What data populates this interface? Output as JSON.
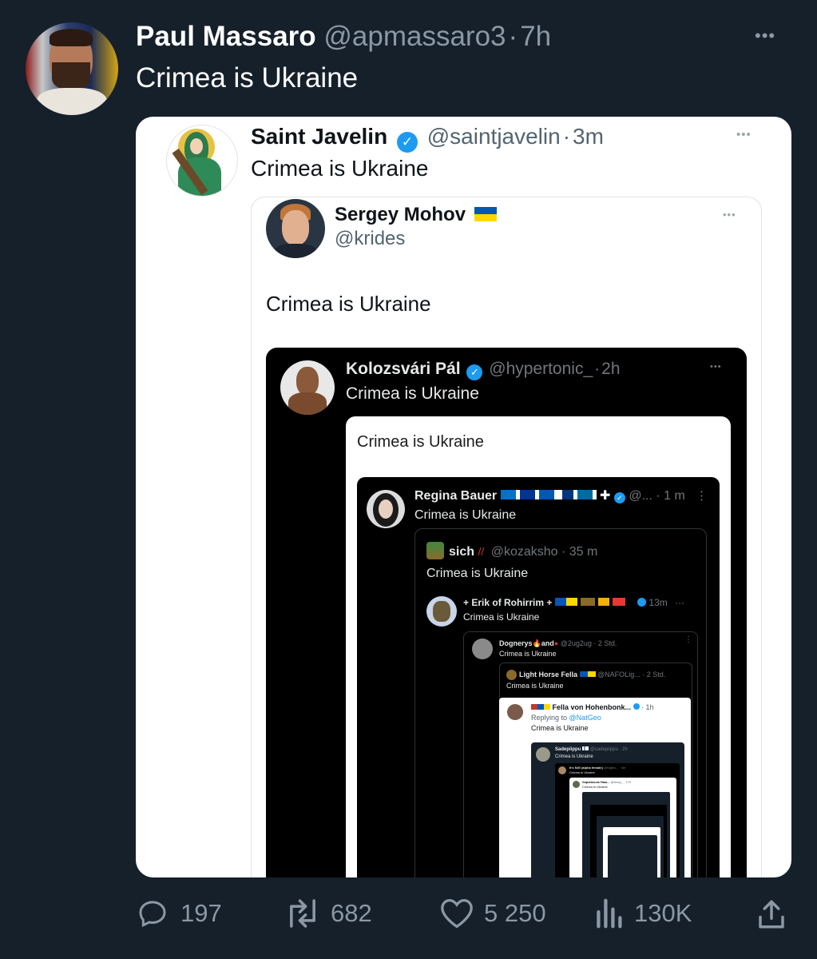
{
  "main": {
    "name": "Paul Massaro",
    "handle": "@apmassaro3",
    "sep": "·",
    "time": "7h",
    "text": "Crimea is Ukraine",
    "more": "•••"
  },
  "q1": {
    "name": "Saint Javelin",
    "handle": "@saintjavelin",
    "sep": "·",
    "time": "3m",
    "text": "Crimea is Ukraine",
    "more": "•••"
  },
  "q2": {
    "name": "Sergey Mohov",
    "flag": "ukraine-flag",
    "handle": "@krides",
    "text": "Crimea is Ukraine",
    "more": "•••"
  },
  "q3": {
    "name": "Kolozsvári Pál",
    "handle": "@hypertonic_",
    "sep": "·",
    "time": "2h",
    "text": "Crimea is Ukraine",
    "more": "•••"
  },
  "q4": {
    "text": "Crimea is Ukraine"
  },
  "q5": {
    "name": "Regina Bauer",
    "handle": "@...",
    "time": "· 1 m",
    "text": "Crimea is Ukraine",
    "more": "⋮"
  },
  "q6": {
    "name": "sich",
    "handle": "@kozaksho",
    "time": "· 35 m",
    "text": "Crimea is Ukraine"
  },
  "q7": {
    "name": "+ Erik of Rohirrim +",
    "time": "13m",
    "text": "Crimea is Ukraine",
    "more": "···"
  },
  "q8": {
    "name": "Dognerys",
    "mid": "and",
    "handle": "@2ug2ug · 2 Std.",
    "text": "Crimea is Ukraine",
    "more": "⋮"
  },
  "q9": {
    "name": "Light Horse Fella",
    "handle": "@NAFOLig... · 2 Std.",
    "text": "Crimea is Ukraine"
  },
  "q10": {
    "name": "Fella von Hohenbonk...",
    "time": "· 1h",
    "reply_prefix": "Replying to",
    "reply_to": "@NatGeo",
    "text": "Crimea is Ukraine"
  },
  "q11": {
    "name": "Sadepiippu",
    "handle": "@sadepiippu · 2h",
    "text": "Crimea is Ukraine"
  },
  "q12": {
    "name": "It's NiG (alpha female)",
    "handle": "@NigBo... · 4m",
    "text": "Crimea is Ukraine"
  },
  "q13": {
    "name": "Харківська Наш...",
    "handle": "@mrcp_ · 17h",
    "text": "Crimea is Ukraine"
  },
  "actions": {
    "replies": "197",
    "reposts": "682",
    "likes": "5 250",
    "views": "130K"
  },
  "colors": {
    "bg": "#15202b",
    "verified": "#1d9bf0",
    "ua_blue": "#0057b7",
    "ua_yellow": "#ffd700"
  }
}
